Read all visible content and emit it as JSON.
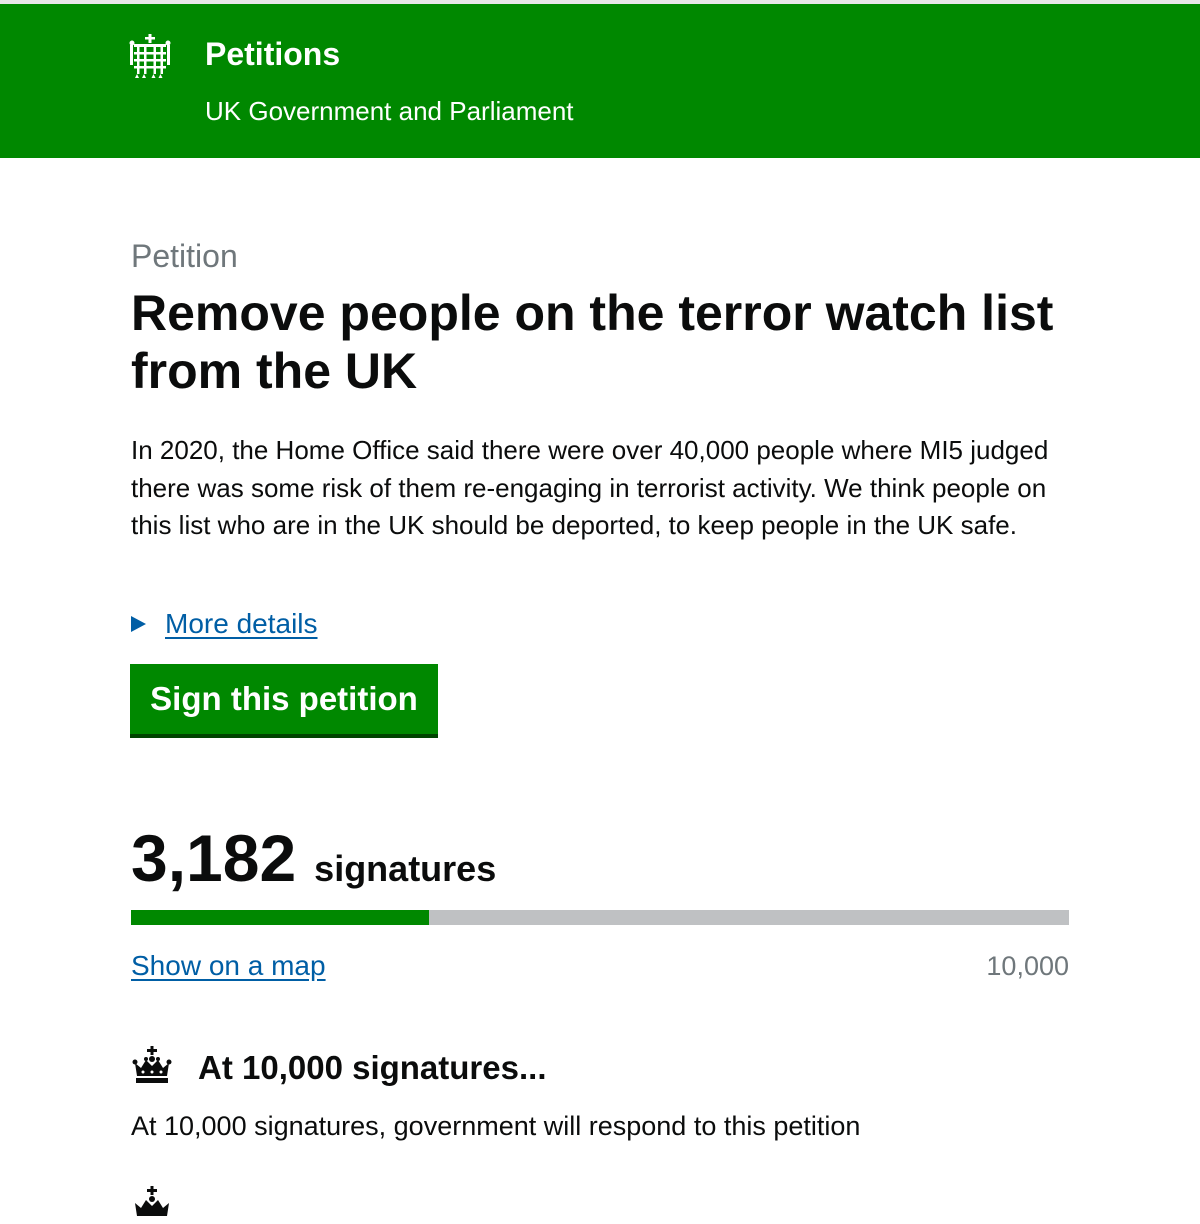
{
  "header": {
    "title": "Petitions",
    "subtitle": "UK Government and Parliament",
    "logo_icon": "portcullis-icon",
    "background_color": "#008800"
  },
  "petition": {
    "kicker": "Petition",
    "title": "Remove people on the terror watch list from the UK",
    "summary": "In 2020, the Home Office said there were over 40,000 people where MI5 judged there was some risk of them re-engaging in terrorist activity. We think people on this list who are in the UK should be deported, to keep people in the UK safe.",
    "more_details_label": "More details",
    "sign_button_label": "Sign this petition"
  },
  "signatures": {
    "count": "3,182",
    "label": "signatures",
    "progress_fraction": 0.3182,
    "map_link_label": "Show on a map",
    "threshold": "10,000"
  },
  "milestones": [
    {
      "icon": "crown-icon",
      "title": "At 10,000 signatures...",
      "text": "At 10,000 signatures, government will respond to this petition"
    }
  ],
  "colors": {
    "accent_green": "#008800",
    "link_blue": "#005ea5",
    "muted_grey": "#6f777b",
    "track_grey": "#bfc1c3"
  }
}
